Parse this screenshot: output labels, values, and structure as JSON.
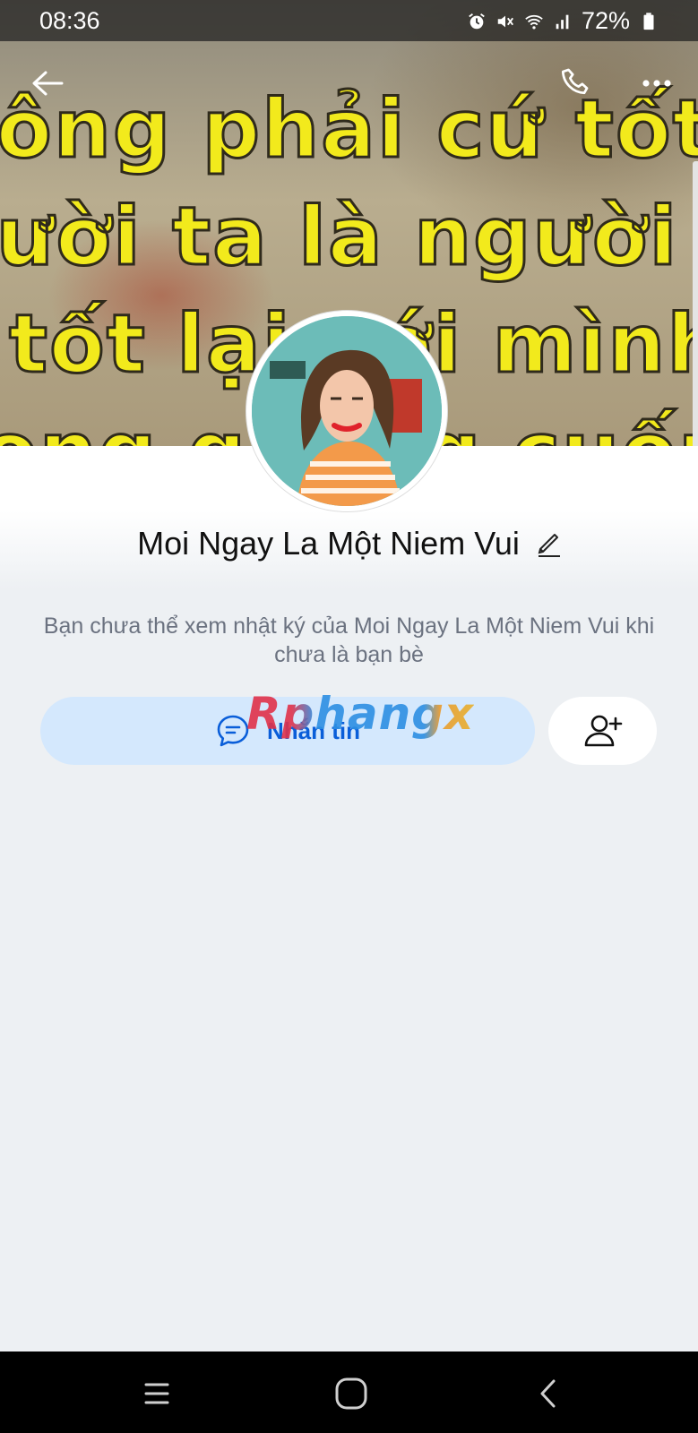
{
  "status_bar": {
    "time": "08:36",
    "battery": "72%",
    "icons": [
      "alarm-icon",
      "mute-icon",
      "wifi-icon",
      "signal-icon",
      "battery-icon"
    ]
  },
  "cover": {
    "lines": [
      "ông phải cứ tốt v",
      "ười ta là người ta",
      "tốt lại với mình",
      "ong gương cuống nơi"
    ]
  },
  "header": {
    "icons": [
      "back-arrow-icon",
      "phone-icon",
      "more-icon"
    ]
  },
  "profile": {
    "name": "Moi Ngay La Một Niem Vui",
    "privacy_note": "Bạn chưa thể xem nhật ký của Moi Ngay La Một Niem Vui khi chưa là bạn bè"
  },
  "actions": {
    "message_label": "Nhắn tin",
    "add_friend_icon": "add-friend-icon"
  },
  "watermark": {
    "text": "Rphangx"
  },
  "colors": {
    "accent": "#0a5ed9",
    "message_button_bg": "#d4e8fd",
    "page_bg": "#edf0f3"
  }
}
